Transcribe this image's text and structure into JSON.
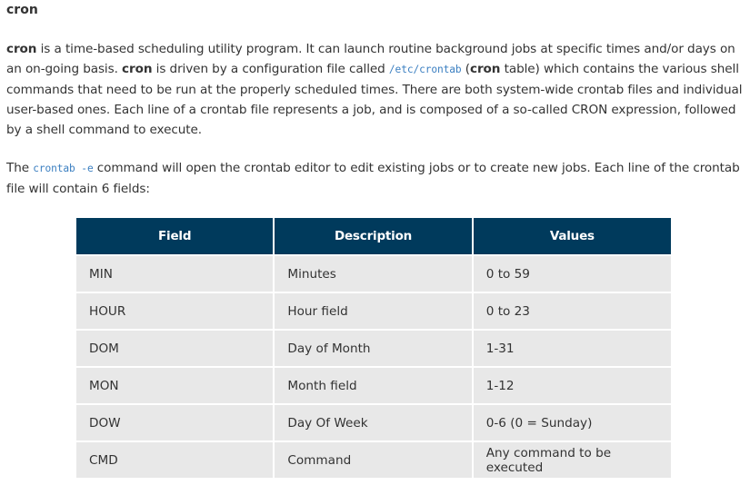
{
  "heading": "cron",
  "intro": {
    "p1": {
      "word_cron": "cron",
      "text1": " is a time-based scheduling utility program. It can launch routine background jobs at specific times and/or days on an on-going basis. ",
      "word_cron2": "cron",
      "text2": " is driven by a configuration file called ",
      "code_path": "/etc/crontab",
      "text3": " (",
      "word_cron3": "cron",
      "text4": " table) which contains the various shell commands that need to be run at the properly scheduled times. There are both system-wide crontab files and individual user-based ones. Each line of a crontab file represents a job, and is composed of a so-called CRON expression, followed by a shell command to execute."
    },
    "p2": {
      "text1": "The ",
      "code_cmd": "crontab -e",
      "text2": " command will open the crontab editor to edit existing jobs or to create new jobs. Each line of the crontab file will contain 6 fields:"
    }
  },
  "table": {
    "headers": [
      "Field",
      "Description",
      "Values"
    ],
    "rows": [
      [
        "MIN",
        "Minutes",
        "0 to 59"
      ],
      [
        "HOUR",
        "Hour field",
        "0 to 23"
      ],
      [
        "DOM",
        "Day of Month",
        "1-31"
      ],
      [
        "MON",
        "Month field",
        "1-12"
      ],
      [
        "DOW",
        "Day Of Week",
        "0-6 (0 = Sunday)"
      ],
      [
        "CMD",
        "Command",
        "Any command to be executed"
      ]
    ]
  },
  "colors": {
    "header_bg": "#003a5c",
    "cell_bg": "#e8e8e8",
    "code_color": "#3b7fc1"
  }
}
